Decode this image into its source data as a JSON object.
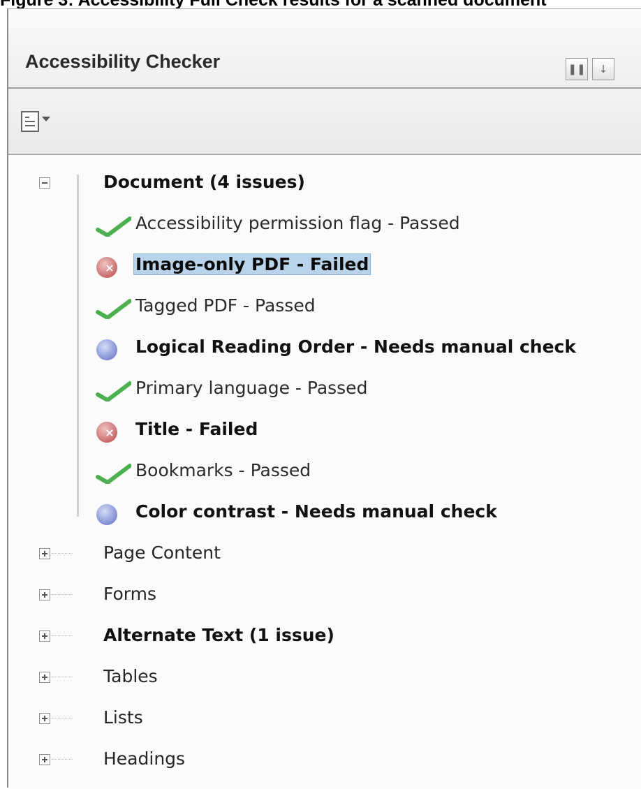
{
  "caption": "Figure 3: Accessibility Full Check results for a scanned document",
  "panel": {
    "title": "Accessibility Checker",
    "toolbar": {
      "options_icon": "list-options-icon"
    }
  },
  "tree": {
    "categories": [
      {
        "label": "Document (4 issues)",
        "bold": true,
        "expanded": true,
        "items": [
          {
            "label": "Accessibility permission flag - Passed",
            "status": "passed",
            "bold": false
          },
          {
            "label": "Image-only PDF - Failed",
            "status": "failed",
            "bold": true,
            "selected": true
          },
          {
            "label": "Tagged PDF - Passed",
            "status": "passed",
            "bold": false
          },
          {
            "label": "Logical Reading Order - Needs manual check",
            "status": "manual",
            "bold": true
          },
          {
            "label": "Primary language - Passed",
            "status": "passed",
            "bold": false
          },
          {
            "label": "Title - Failed",
            "status": "failed",
            "bold": true
          },
          {
            "label": "Bookmarks - Passed",
            "status": "passed",
            "bold": false
          },
          {
            "label": "Color contrast - Needs manual check",
            "status": "manual",
            "bold": true
          }
        ]
      },
      {
        "label": "Page Content",
        "bold": false,
        "expanded": false
      },
      {
        "label": "Forms",
        "bold": false,
        "expanded": false
      },
      {
        "label": "Alternate Text (1 issue)",
        "bold": true,
        "expanded": false
      },
      {
        "label": "Tables",
        "bold": false,
        "expanded": false
      },
      {
        "label": "Lists",
        "bold": false,
        "expanded": false
      },
      {
        "label": "Headings",
        "bold": false,
        "expanded": false
      }
    ]
  },
  "colors": {
    "selection": "#b9d4ea",
    "passed": "#4caf50",
    "failed": "#c96a6a",
    "manual": "#7f8ed3"
  }
}
